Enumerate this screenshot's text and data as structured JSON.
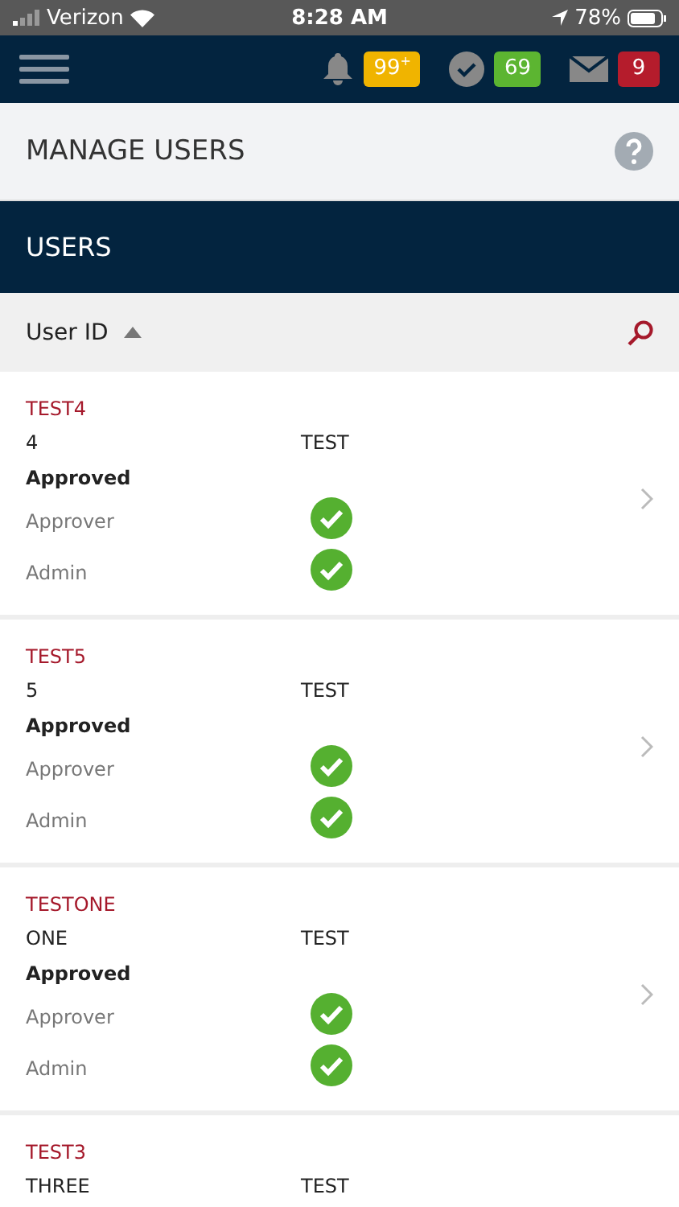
{
  "status_bar": {
    "carrier": "Verizon",
    "time": "8:28 AM",
    "battery": "78%"
  },
  "nav": {
    "badges": [
      {
        "kind": "bell",
        "count": "99",
        "sup": "+",
        "color": "#f0b400"
      },
      {
        "kind": "check",
        "count": "69",
        "color": "#5cb531"
      },
      {
        "kind": "mail",
        "count": "9",
        "color": "#b51c2c"
      }
    ]
  },
  "page_title": "MANAGE USERS",
  "section_title": "USERS",
  "sort": {
    "label": "User ID"
  },
  "users": [
    {
      "id": "TEST4",
      "first_name": "4",
      "last_name": "TEST",
      "status": "Approved",
      "roles": [
        {
          "label": "Approver",
          "checked": true
        },
        {
          "label": "Admin",
          "checked": true
        }
      ]
    },
    {
      "id": "TEST5",
      "first_name": "5",
      "last_name": "TEST",
      "status": "Approved",
      "roles": [
        {
          "label": "Approver",
          "checked": true
        },
        {
          "label": "Admin",
          "checked": true
        }
      ]
    },
    {
      "id": "TESTONE",
      "first_name": "ONE",
      "last_name": "TEST",
      "status": "Approved",
      "roles": [
        {
          "label": "Approver",
          "checked": true
        },
        {
          "label": "Admin",
          "checked": true
        }
      ]
    },
    {
      "id": "TEST3",
      "first_name": "THREE",
      "last_name": "TEST"
    }
  ]
}
